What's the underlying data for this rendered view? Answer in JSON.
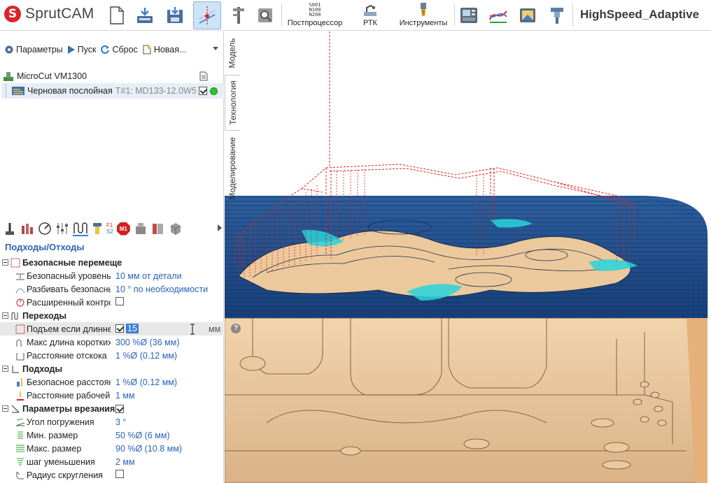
{
  "app": {
    "logo_text": "SprutCAM",
    "logo_mark": "S",
    "project_name": "HighSpeed_Adaptive"
  },
  "toolbar": {
    "postprocessor_label": "Постпроцессор",
    "postprocessor_codes": [
      "%001",
      "N100",
      "N200"
    ],
    "rtk_label": "РТК",
    "tools_label": "Инструменты"
  },
  "commands": {
    "params": "Параметры",
    "run": "Пуск",
    "reset": "Сброс",
    "new": "Новая..."
  },
  "tree": {
    "machine": "MicroCut VM1300",
    "operation_name": "Черновая послойная",
    "operation_tool": "T#1: MD133-12.0W5"
  },
  "side_tabs": {
    "model": "Модель",
    "technology": "Технология",
    "modeling": "Моделирование"
  },
  "panel": {
    "section_title": "Подходы/Отходы",
    "op_tabs": [
      "F1",
      "S2",
      "M1"
    ]
  },
  "props": {
    "g1": "Безопасные перемещения",
    "safe_level": {
      "name": "Безопасный уровень",
      "value": "10 мм от детали"
    },
    "split_safe": {
      "name": "Разбивать безопасные",
      "value": "10 ° по необходимости"
    },
    "extended_control": {
      "name": "Расширенный контроль"
    },
    "g2": "Переходы",
    "lift_if_longer": {
      "name": "Подъем если длиннее",
      "value": "15",
      "unit": "мм"
    },
    "max_short_len": {
      "name": "Макс длина коротких",
      "value": "300 %Ø (36 мм)"
    },
    "retract_dist": {
      "name": "Расстояние отскока",
      "value": "1 %Ø (0.12 мм)"
    },
    "g3": "Подходы",
    "safe_dist": {
      "name": "Безопасное расстояние",
      "value": "1 %Ø (0.12 мм)"
    },
    "work_dist": {
      "name": "Расстояние рабочей",
      "value": "1 мм"
    },
    "g4": "Параметры врезания",
    "plunge_angle": {
      "name": "Угол погружения",
      "value": "3 °"
    },
    "min_size": {
      "name": "Мин. размер",
      "value": "50 %Ø (6 мм)"
    },
    "max_size": {
      "name": "Макс. размер",
      "value": "90 %Ø (10.8 мм)"
    },
    "step_decrease": {
      "name": "шаг уменьшения",
      "value": "2 мм"
    },
    "round_radius": {
      "name": "Радиус скругления"
    }
  },
  "help_mark": "?",
  "colors": {
    "accent": "#2a63b8",
    "toolpath_rapid": "#e02020",
    "toolpath_cut": "#1d4f91",
    "part": "#f3d7b4",
    "highlight": "#29d3dc"
  }
}
